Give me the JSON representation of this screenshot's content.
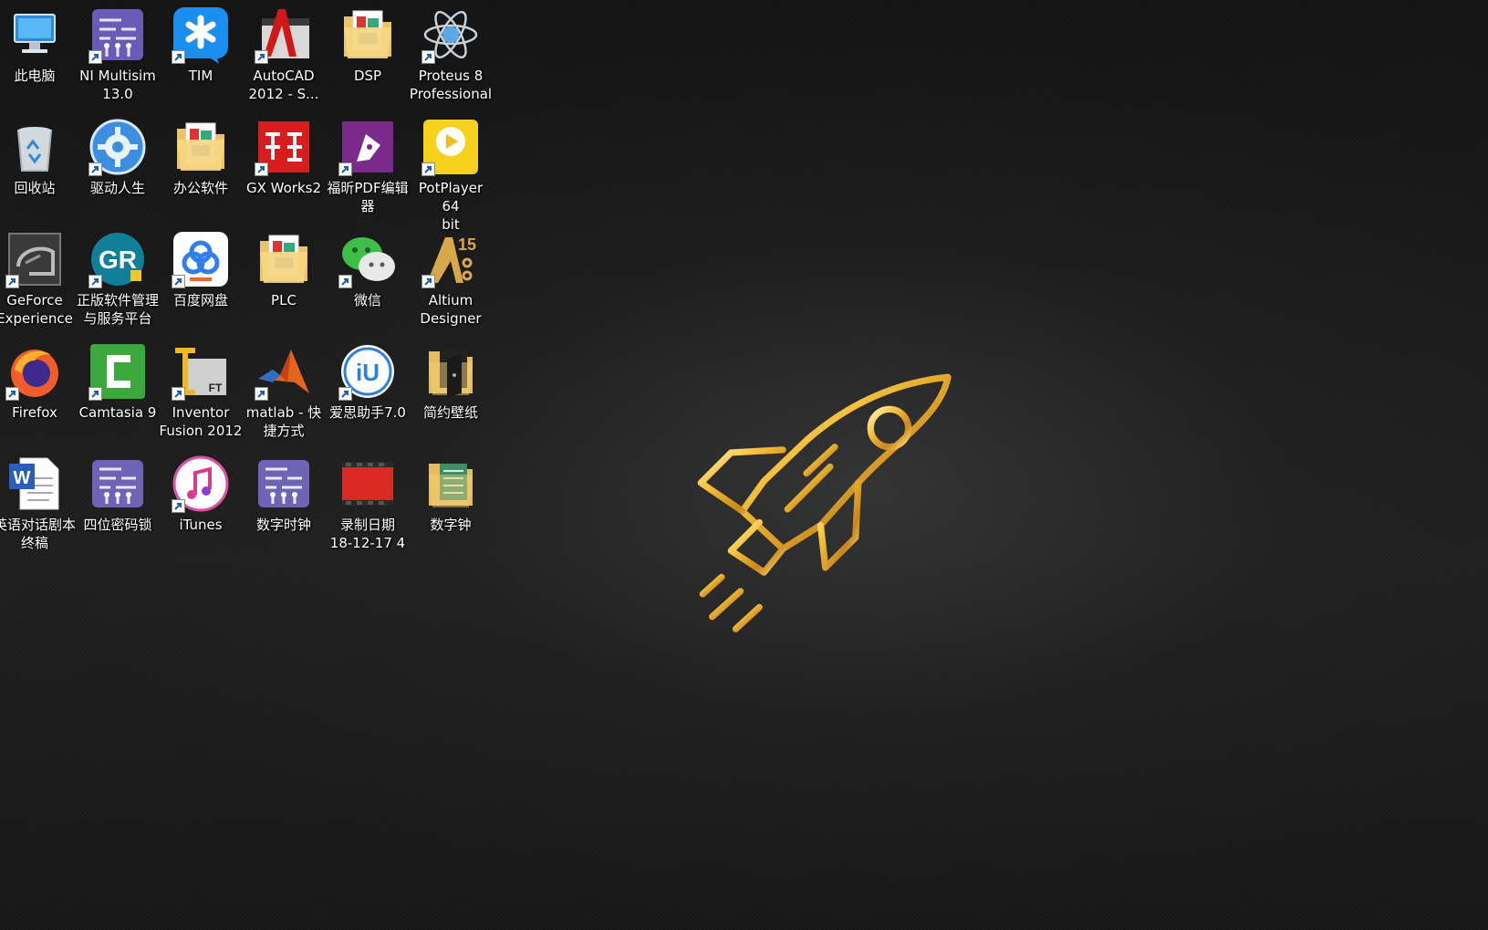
{
  "desktop": {
    "icons": [
      {
        "id": "this-pc",
        "label": "此电脑",
        "icon": "computer-icon",
        "shortcut": false
      },
      {
        "id": "ni-multisim",
        "label": "NI Multisim\n13.0",
        "icon": "multisim-icon",
        "shortcut": true
      },
      {
        "id": "tim",
        "label": "TIM",
        "icon": "tim-icon",
        "shortcut": true
      },
      {
        "id": "autocad",
        "label": "AutoCAD\n2012 - S...",
        "icon": "autocad-icon",
        "shortcut": true
      },
      {
        "id": "dsp",
        "label": "DSP",
        "icon": "folder-icon",
        "shortcut": false
      },
      {
        "id": "proteus",
        "label": "Proteus 8\nProfessional",
        "icon": "proteus-icon",
        "shortcut": true
      },
      {
        "id": "recycle-bin",
        "label": "回收站",
        "icon": "recycle-bin-icon",
        "shortcut": false
      },
      {
        "id": "driver-life",
        "label": "驱动人生",
        "icon": "gear-icon",
        "shortcut": true
      },
      {
        "id": "office-software",
        "label": "办公软件",
        "icon": "folder-icon",
        "shortcut": false
      },
      {
        "id": "gx-works2",
        "label": "GX Works2",
        "icon": "gx-works-icon",
        "shortcut": true
      },
      {
        "id": "foxit-pdf",
        "label": "福昕PDF编辑\n器",
        "icon": "pdf-editor-icon",
        "shortcut": true
      },
      {
        "id": "potplayer",
        "label": "PotPlayer 64\nbit",
        "icon": "potplayer-icon",
        "shortcut": true
      },
      {
        "id": "geforce",
        "label": "GeForce\nExperience",
        "icon": "geforce-icon",
        "shortcut": true
      },
      {
        "id": "software-platform",
        "label": "正版软件管理\n与服务平台",
        "icon": "gr-platform-icon",
        "shortcut": true
      },
      {
        "id": "baidu-netdisk",
        "label": "百度网盘",
        "icon": "cloud-drive-icon",
        "shortcut": true
      },
      {
        "id": "plc",
        "label": "PLC",
        "icon": "folder-icon",
        "shortcut": false
      },
      {
        "id": "wechat",
        "label": "微信",
        "icon": "wechat-icon",
        "shortcut": true
      },
      {
        "id": "altium",
        "label": "Altium\nDesigner",
        "icon": "altium-icon",
        "shortcut": true
      },
      {
        "id": "firefox",
        "label": "Firefox",
        "icon": "firefox-icon",
        "shortcut": true
      },
      {
        "id": "camtasia",
        "label": "Camtasia 9",
        "icon": "camtasia-icon",
        "shortcut": true
      },
      {
        "id": "inventor-fusion",
        "label": "Inventor\nFusion 2012",
        "icon": "inventor-icon",
        "shortcut": true
      },
      {
        "id": "matlab",
        "label": "matlab - 快\n捷方式",
        "icon": "matlab-icon",
        "shortcut": true
      },
      {
        "id": "i4-assistant",
        "label": "爱思助手7.0",
        "icon": "i4-icon",
        "shortcut": true
      },
      {
        "id": "simple-wallpaper",
        "label": "简约壁纸",
        "icon": "dark-folder-icon",
        "shortcut": false
      },
      {
        "id": "english-script",
        "label": "英语对话剧本\n终稿",
        "icon": "word-document-icon",
        "shortcut": false
      },
      {
        "id": "four-digit-lock",
        "label": "四位密码锁",
        "icon": "multisim-file-icon",
        "shortcut": false
      },
      {
        "id": "itunes",
        "label": "iTunes",
        "icon": "itunes-icon",
        "shortcut": true
      },
      {
        "id": "digital-clock-file",
        "label": "数字时钟",
        "icon": "multisim-file-icon",
        "shortcut": false
      },
      {
        "id": "recording",
        "label": "录制日期\n18-12-17 4",
        "icon": "video-file-icon",
        "shortcut": false
      },
      {
        "id": "digital-clock-folder",
        "label": "数字钟",
        "icon": "green-folder-icon",
        "shortcut": false
      }
    ]
  },
  "wallpaper": {
    "motif": "rocket-icon",
    "rocket_color": "#f3c13a",
    "background_color": "#1b1b1b"
  }
}
